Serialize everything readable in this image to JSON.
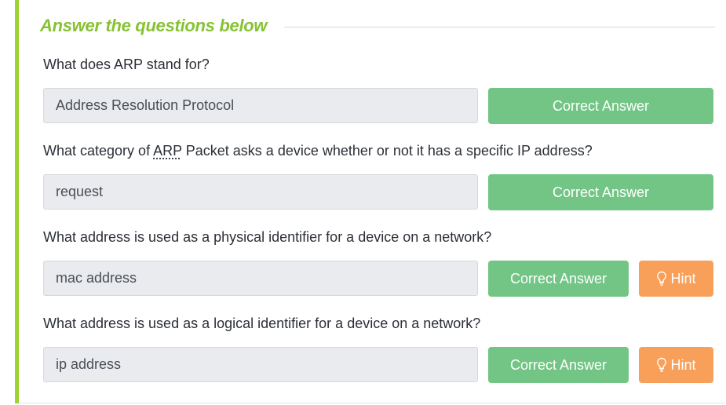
{
  "section": {
    "title": "Answer the questions below"
  },
  "questions": [
    {
      "text": "What does ARP stand for?",
      "answer": "Address Resolution Protocol",
      "correct_label": "Correct Answer"
    },
    {
      "text_before": "What category of ",
      "abbr": "ARP",
      "text_after": " Packet asks a device whether or not it has a specific IP address?",
      "answer": "request",
      "correct_label": "Correct Answer"
    },
    {
      "text": "What address is used as a physical identifier for a device on a network?",
      "answer": "mac address",
      "correct_label": "Correct Answer",
      "hint_label": "Hint"
    },
    {
      "text": "What address is used as a logical identifier for a device on a network?",
      "answer": "ip address",
      "correct_label": "Correct Answer",
      "hint_label": "Hint"
    }
  ],
  "colors": {
    "accent_green": "#86c232",
    "correct_button": "#72c584",
    "hint_button": "#f8a05a"
  },
  "icons": {
    "hint": "lightbulb-icon"
  }
}
